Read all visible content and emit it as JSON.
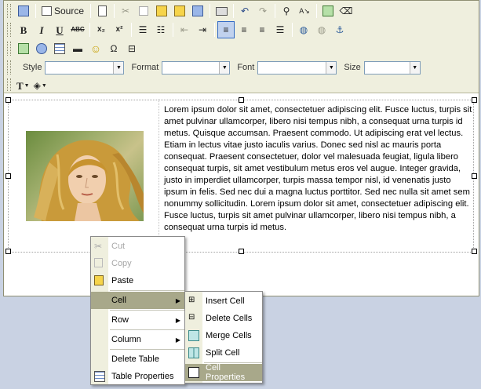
{
  "toolbar": {
    "source_label": "Source",
    "style_label": "Style",
    "format_label": "Format",
    "font_label": "Font",
    "size_label": "Size",
    "bold_glyph": "B",
    "italic_glyph": "I",
    "underline_glyph": "U",
    "strike_glyph": "ABC",
    "subscript_glyph": "x₂",
    "superscript_glyph": "x²",
    "text_color_glyph": "T",
    "active_button": "align-left"
  },
  "content": {
    "paragraph": "Lorem ipsum dolor sit amet, consectetuer adipiscing elit. Fusce luctus, turpis sit amet pulvinar ullamcorper, libero nisi tempus nibh, a consequat urna turpis id metus. Quisque accumsan. Praesent commodo. Ut adipiscing erat vel lectus. Etiam in lectus vitae justo iaculis varius. Donec sed nisl ac mauris porta consequat. Praesent consectetuer, dolor vel malesuada feugiat, ligula libero consequat turpis, sit amet vestibulum metus eros vel augue. Integer gravida, justo in imperdiet ullamcorper, turpis massa tempor nisl, id venenatis justo ipsum in felis. Sed nec dui a magna luctus porttitor. Sed nec nulla sit amet sem nonummy sollicitudin. Lorem ipsum dolor sit amet, consectetuer adipiscing elit. Fusce luctus, turpis sit amet pulvinar ullamcorper, libero nisi tempus nibh, a consequat urna turpis id metus."
  },
  "context_menu": {
    "items": {
      "cut": "Cut",
      "copy": "Copy",
      "paste": "Paste",
      "cell": "Cell",
      "row": "Row",
      "column": "Column",
      "delete_table": "Delete Table",
      "table_properties": "Table Properties"
    }
  },
  "cell_submenu": {
    "items": {
      "insert_cell": "Insert Cell",
      "delete_cells": "Delete Cells",
      "merge_cells": "Merge Cells",
      "split_cell": "Split Cell",
      "cell_properties": "Cell Properties"
    }
  },
  "colors": {
    "toolbar_bg": "#efefde",
    "menu_hover": "#a8a88a",
    "desktop_bg": "#c9d2e3",
    "active_button_bg": "#c1d2ee"
  }
}
